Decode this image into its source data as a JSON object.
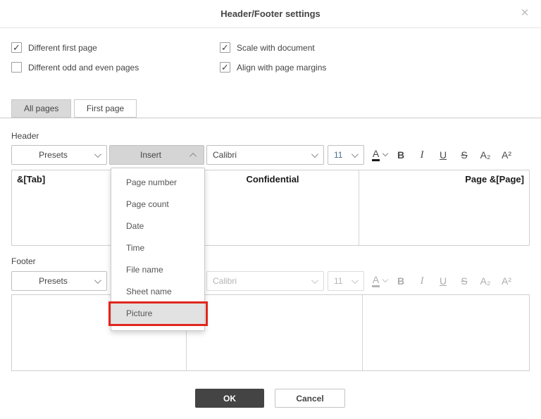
{
  "colors": {
    "accent": "#444444",
    "annotation-red": "#e0261d",
    "size-text": "#4a708c",
    "menu-highlight": "#e2e2e2"
  },
  "dialog": {
    "title": "Header/Footer settings",
    "close_glyph": "×"
  },
  "options": {
    "col1": [
      {
        "label": "Different first page",
        "mark": "✓"
      },
      {
        "label": "Different odd and even pages",
        "mark": ""
      }
    ],
    "col2": [
      {
        "label": "Scale with document",
        "mark": "✓"
      },
      {
        "label": "Align with page margins",
        "mark": "✓"
      }
    ]
  },
  "tabs": [
    {
      "label": "All pages"
    },
    {
      "label": "First page"
    }
  ],
  "header_section": {
    "label": "Header",
    "toolbar": {
      "presets": "Presets",
      "insert": "Insert",
      "font_name": "Calibri",
      "font_size": "11",
      "font_color": "A",
      "bold": "B",
      "italic": "I",
      "underline": "U",
      "strikethrough": "S",
      "subscript": "A₂",
      "superscript": "A²"
    },
    "preview": {
      "left": "&[Tab]",
      "center": "Confidential",
      "right": "Page &[Page]"
    }
  },
  "insert_menu": {
    "items": [
      "Page number",
      "Page count",
      "Date",
      "Time",
      "File name",
      "Sheet name",
      "Picture"
    ],
    "highlighted_item": "Picture"
  },
  "footer_section": {
    "label": "Footer",
    "toolbar": {
      "presets": "Presets",
      "font_name": "Calibri",
      "font_size": "11",
      "font_color": "A",
      "bold": "B",
      "italic": "I",
      "underline": "U",
      "strikethrough": "S",
      "subscript": "A₂",
      "superscript": "A²"
    },
    "preview": {
      "left": "",
      "center": "",
      "right": ""
    }
  },
  "actions": {
    "ok": "OK",
    "cancel": "Cancel"
  }
}
